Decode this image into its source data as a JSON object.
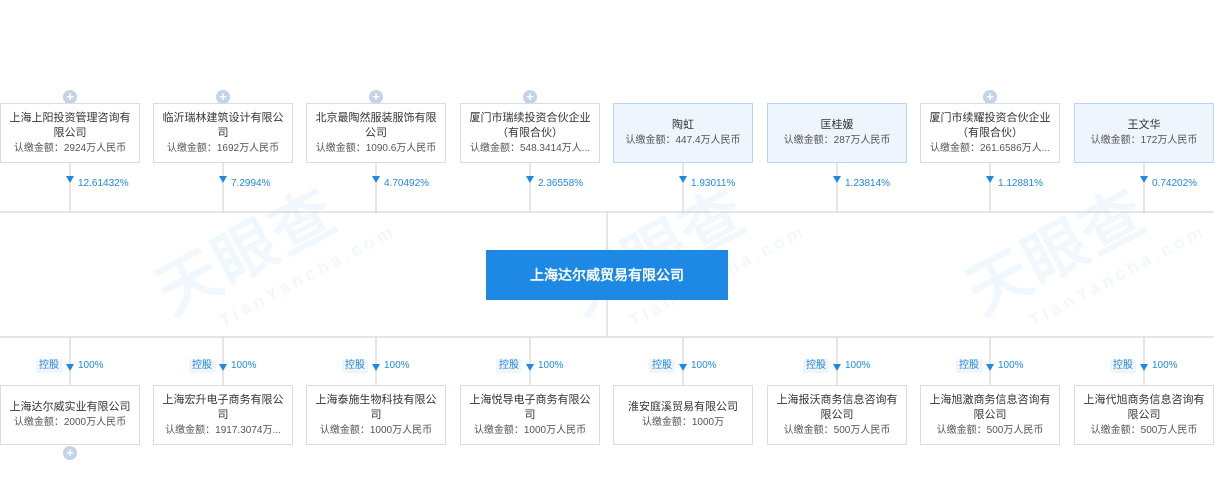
{
  "watermark": {
    "main": "天眼查",
    "sub": "TianYancha.com"
  },
  "center": {
    "name": "上海达尔威贸易有限公司"
  },
  "shareholders": [
    {
      "name": "上海上阳投资管理咨询有限公司",
      "amount": "认缴金额：2924万人民币",
      "percent": "12.61432%",
      "type": "company",
      "expandable": true
    },
    {
      "name": "临沂瑞林建筑设计有限公司",
      "amount": "认缴金额：1692万人民币",
      "percent": "7.2994%",
      "type": "company",
      "expandable": true
    },
    {
      "name": "北京最陶然服装服饰有限公司",
      "amount": "认缴金额：1090.6万人民币",
      "percent": "4.70492%",
      "type": "company",
      "expandable": true
    },
    {
      "name": "厦门市瑞续投资合伙企业（有限合伙）",
      "amount": "认缴金额：548.3414万人...",
      "percent": "2.36558%",
      "type": "company",
      "expandable": true
    },
    {
      "name": "陶虹",
      "amount": "认缴金额：447.4万人民币",
      "percent": "1.93011%",
      "type": "person",
      "expandable": false
    },
    {
      "name": "匡桂媛",
      "amount": "认缴金额：287万人民币",
      "percent": "1.23814%",
      "type": "person",
      "expandable": false
    },
    {
      "name": "厦门市续耀投资合伙企业（有限合伙）",
      "amount": "认缴金额：261.6586万人...",
      "percent": "1.12881%",
      "type": "company",
      "expandable": true
    },
    {
      "name": "王文华",
      "amount": "认缴金额：172万人民币",
      "percent": "0.74202%",
      "type": "person",
      "expandable": false
    }
  ],
  "subsidiaries": [
    {
      "name": "上海达尔威实业有限公司",
      "amount": "认缴金额：2000万人民币",
      "percent": "100%",
      "badge": "控股",
      "expandable": true
    },
    {
      "name": "上海宏升电子商务有限公司",
      "amount": "认缴金额：1917.3074万...",
      "percent": "100%",
      "badge": "控股",
      "expandable": false
    },
    {
      "name": "上海泰施生物科技有限公司",
      "amount": "认缴金额：1000万人民币",
      "percent": "100%",
      "badge": "控股",
      "expandable": false
    },
    {
      "name": "上海悦导电子商务有限公司",
      "amount": "认缴金额：1000万人民币",
      "percent": "100%",
      "badge": "控股",
      "expandable": false
    },
    {
      "name": "淮安庭溪贸易有限公司",
      "amount": "认缴金额：1000万",
      "percent": "100%",
      "badge": "控股",
      "expandable": false
    },
    {
      "name": "上海报沃商务信息咨询有限公司",
      "amount": "认缴金额：500万人民币",
      "percent": "100%",
      "badge": "控股",
      "expandable": false
    },
    {
      "name": "上海旭激商务信息咨询有限公司",
      "amount": "认缴金额：500万人民币",
      "percent": "100%",
      "badge": "控股",
      "expandable": false
    },
    {
      "name": "上海代旭商务信息咨询有限公司",
      "amount": "认缴金额：500万人民币",
      "percent": "100%",
      "badge": "控股",
      "expandable": false
    }
  ]
}
